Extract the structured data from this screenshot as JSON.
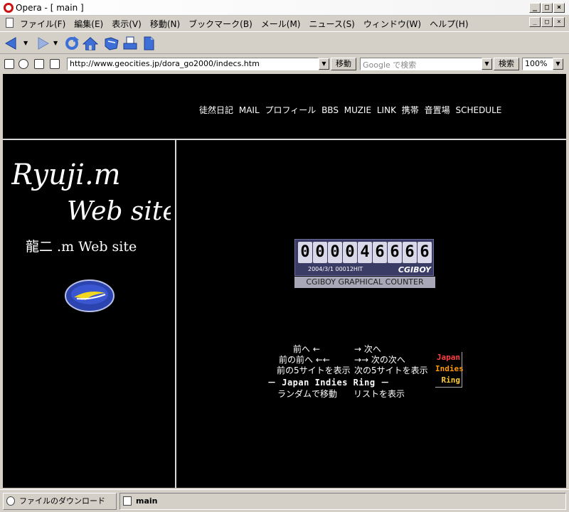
{
  "window": {
    "title": "Opera - [ main ]",
    "controls": {
      "minimize": "_",
      "maximize": "□",
      "close": "×"
    }
  },
  "menu": {
    "items": [
      "ファイル(F)",
      "編集(E)",
      "表示(V)",
      "移動(N)",
      "ブックマーク(B)",
      "メール(M)",
      "ニュース(S)",
      "ウィンドウ(W)",
      "ヘルプ(H)"
    ]
  },
  "toolbar": {
    "icons": [
      "back-arrow-icon",
      "forward-arrow-icon",
      "reload-icon",
      "home-icon",
      "hotlist-icon",
      "print-icon",
      "document-icon"
    ]
  },
  "address": {
    "url": "http://www.geocities.jp/dora_go2000/indecs.htm",
    "go_label": "移動",
    "search_placeholder": "Google で検索",
    "search_label": "検索",
    "zoom": "100%"
  },
  "page": {
    "nav": [
      "徒然日記",
      "MAIL",
      "プロフィール",
      "BBS",
      "MUZIE",
      "LINK",
      "携帯",
      "音置場",
      "SCHEDULE"
    ],
    "logo_line1": "Ryuji.m",
    "logo_line2": "Web site",
    "site_name_jp": "龍二 .m Web site",
    "counter": {
      "digits": [
        "0",
        "0",
        "0",
        "0",
        "4",
        "6",
        "6",
        "6",
        "6"
      ],
      "date": "2004/3/1 00012HIT",
      "brand": "CGIBOY",
      "label": "CGIBOY GRAPHICAL COUNTER"
    },
    "ring": {
      "prev": "前へ ←",
      "next": "→ 次へ",
      "prev2": "前の前へ ←←",
      "next2": "→→ 次の次へ",
      "prev5": "前の5サイトを表示",
      "next5": "次の5サイトを表示",
      "title": "－ Japan Indies Ring －",
      "random": "ランダムで移動",
      "list": "リストを表示",
      "badge": [
        "Japan",
        "Indies",
        "Ring"
      ]
    }
  },
  "status": {
    "download_label": "ファイルのダウンロード",
    "tab_label": "main"
  },
  "colors": {
    "page_background": "#000000",
    "chrome": "#d4d0c8",
    "badge_japan": "#ff4040",
    "badge_indies": "#ff9900",
    "badge_ring": "#ffcc33"
  }
}
